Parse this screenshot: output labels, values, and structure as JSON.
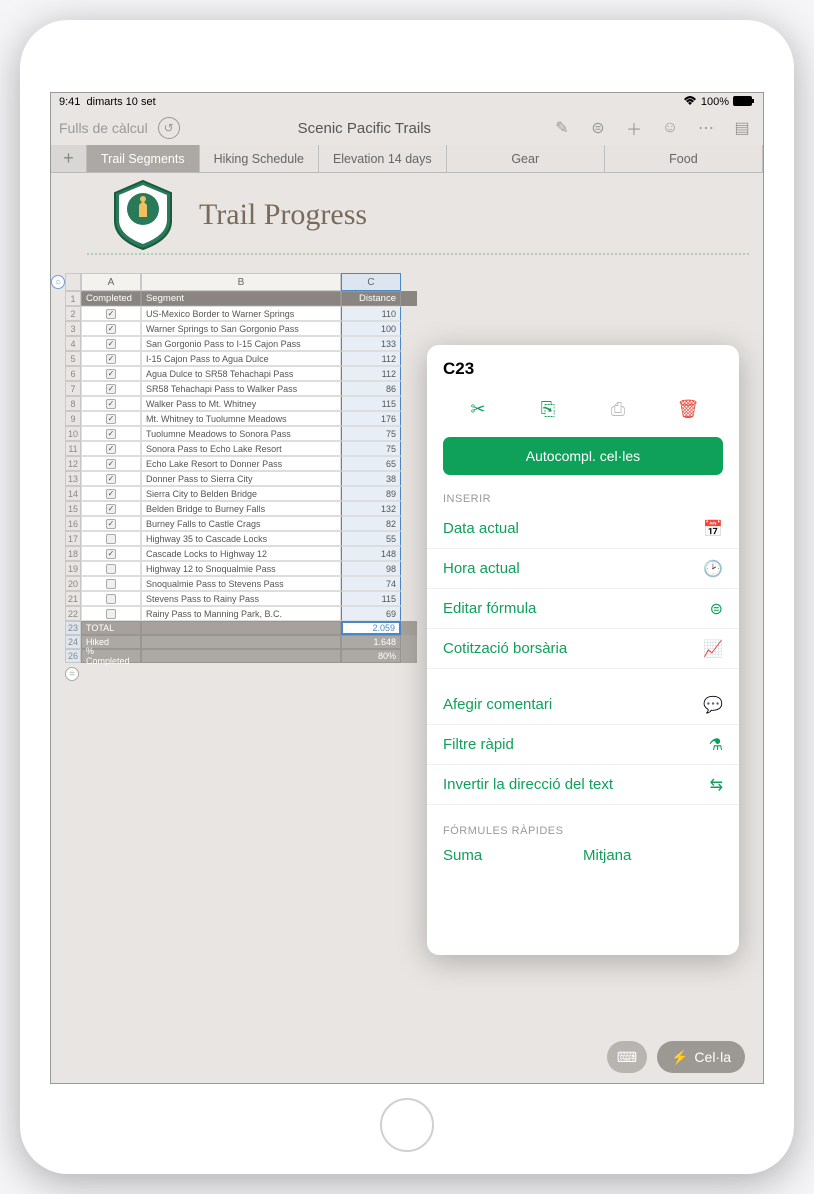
{
  "status": {
    "time": "9:41",
    "date": "dimarts 10 set",
    "battery": "100%"
  },
  "toolbar": {
    "back": "Fulls de càlcul",
    "title": "Scenic Pacific Trails"
  },
  "tabs": [
    "Trail Segments",
    "Hiking Schedule",
    "Elevation 14 days",
    "Gear",
    "Food"
  ],
  "pageTitle": "Trail Progress",
  "columns": {
    "A": "A",
    "B": "B",
    "C": "C"
  },
  "headers": {
    "A": "Completed",
    "B": "Segment",
    "C": "Distance"
  },
  "rows": [
    {
      "n": 2,
      "done": true,
      "seg": "US-Mexico Border to Warner Springs",
      "dist": "110"
    },
    {
      "n": 3,
      "done": true,
      "seg": "Warner Springs to San Gorgonio Pass",
      "dist": "100"
    },
    {
      "n": 4,
      "done": true,
      "seg": "San Gorgonio Pass to I-15 Cajon Pass",
      "dist": "133"
    },
    {
      "n": 5,
      "done": true,
      "seg": "I-15 Cajon Pass to Agua Dulce",
      "dist": "112"
    },
    {
      "n": 6,
      "done": true,
      "seg": "Agua Dulce to SR58 Tehachapi Pass",
      "dist": "112"
    },
    {
      "n": 7,
      "done": true,
      "seg": "SR58 Tehachapi Pass to Walker Pass",
      "dist": "86"
    },
    {
      "n": 8,
      "done": true,
      "seg": "Walker Pass to Mt. Whitney",
      "dist": "115"
    },
    {
      "n": 9,
      "done": true,
      "seg": "Mt. Whitney to Tuolumne Meadows",
      "dist": "176"
    },
    {
      "n": 10,
      "done": true,
      "seg": "Tuolumne Meadows to Sonora Pass",
      "dist": "75"
    },
    {
      "n": 11,
      "done": true,
      "seg": "Sonora Pass to Echo Lake Resort",
      "dist": "75"
    },
    {
      "n": 12,
      "done": true,
      "seg": "Echo Lake Resort to Donner Pass",
      "dist": "65"
    },
    {
      "n": 13,
      "done": true,
      "seg": "Donner Pass to Sierra City",
      "dist": "38"
    },
    {
      "n": 14,
      "done": true,
      "seg": "Sierra City to Belden Bridge",
      "dist": "89"
    },
    {
      "n": 15,
      "done": true,
      "seg": "Belden Bridge to Burney Falls",
      "dist": "132"
    },
    {
      "n": 16,
      "done": true,
      "seg": "Burney Falls to Castle Crags",
      "dist": "82"
    },
    {
      "n": 17,
      "done": false,
      "seg": "Highway 35 to Cascade Locks",
      "dist": "55"
    },
    {
      "n": 18,
      "done": true,
      "seg": "Cascade Locks to Highway 12",
      "dist": "148"
    },
    {
      "n": 19,
      "done": false,
      "seg": "Highway 12 to Snoqualmie Pass",
      "dist": "98"
    },
    {
      "n": 20,
      "done": false,
      "seg": "Snoqualmie Pass to Stevens Pass",
      "dist": "74"
    },
    {
      "n": 21,
      "done": false,
      "seg": "Stevens Pass to Rainy Pass",
      "dist": "115"
    },
    {
      "n": 22,
      "done": false,
      "seg": "Rainy Pass to Manning Park, B.C.",
      "dist": "69"
    }
  ],
  "footers": {
    "total": {
      "n": 23,
      "label": "TOTAL",
      "val": "2.059"
    },
    "hiked": {
      "n": 24,
      "label": "Hiked",
      "val": "1.648"
    },
    "pct": {
      "n": 26,
      "label": "% Completed",
      "val": "80%"
    }
  },
  "popover": {
    "cell": "C23",
    "autofill": "Autocompl. cel·les",
    "sections": {
      "insert": "INSERIR",
      "formulas": "FÓRMULES RÀPIDES"
    },
    "items": {
      "insert": [
        {
          "label": "Data actual",
          "icon": "calendar-icon"
        },
        {
          "label": "Hora actual",
          "icon": "clock-icon"
        },
        {
          "label": "Editar fórmula",
          "icon": "equals-icon"
        },
        {
          "label": "Cotització borsària",
          "icon": "chart-icon"
        }
      ],
      "other": [
        {
          "label": "Afegir comentari",
          "icon": "comment-icon"
        },
        {
          "label": "Filtre ràpid",
          "icon": "filter-icon"
        },
        {
          "label": "Invertir la direcció del text",
          "icon": "swap-icon"
        }
      ],
      "quick": [
        "Suma",
        "Mitjana"
      ]
    }
  },
  "pills": {
    "cell": "Cel·la"
  }
}
